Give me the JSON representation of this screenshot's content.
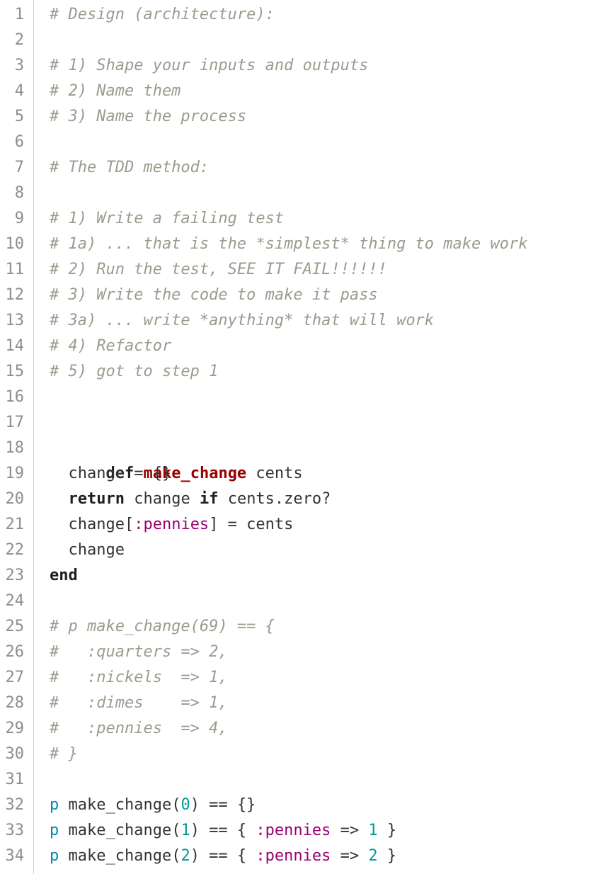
{
  "editor": {
    "line_numbers": [
      "1",
      "2",
      "3",
      "4",
      "5",
      "6",
      "7",
      "8",
      "9",
      "10",
      "11",
      "12",
      "13",
      "14",
      "15",
      "16",
      "17",
      "18",
      "19",
      "20",
      "21",
      "22",
      "23",
      "24",
      "25",
      "26",
      "27",
      "28",
      "29",
      "30",
      "31",
      "32",
      "33",
      "34"
    ],
    "comments": {
      "l1": "# Design (architecture):",
      "l3": "# 1) Shape your inputs and outputs",
      "l4": "# 2) Name them",
      "l5": "# 3) Name the process",
      "l7": "# The TDD method:",
      "l9": "# 1) Write a failing test",
      "l10": "# 1a) ... that is the *simplest* thing to make work",
      "l11": "# 2) Run the test, SEE IT FAIL!!!!!!",
      "l12": "# 3) Write the code to make it pass",
      "l13": "# 3a) ... write *anything* that will work",
      "l14": "# 4) Refactor",
      "l15": "# 5) got to step 1",
      "l25": "# p make_change(69) == {",
      "l26": "#   :quarters => 2,",
      "l27": "#   :nickels  => 1,",
      "l28": "#   :dimes    => 1,",
      "l29": "#   :pennies  => 4,",
      "l30": "# }"
    },
    "code": {
      "def_kw": "def",
      "method_name": "make_change",
      "param": " cents",
      "l19": "  change = {}",
      "return_kw": "return",
      "l20_mid": " change ",
      "if_kw": "if",
      "l20_end": " cents.zero?",
      "l21_a": "  change[",
      "l21_sym": ":pennies",
      "l21_b": "] = cents",
      "l22": "  change",
      "end_kw": "end",
      "p_kw": "p",
      "call": " make_change(",
      "zero": "0",
      "one": "1",
      "two": "2",
      "l32_end": ") == {}",
      "l33_mid": ") == { ",
      "pennies_sym": ":pennies",
      "arrow": " => ",
      "close_brace": " }"
    }
  }
}
